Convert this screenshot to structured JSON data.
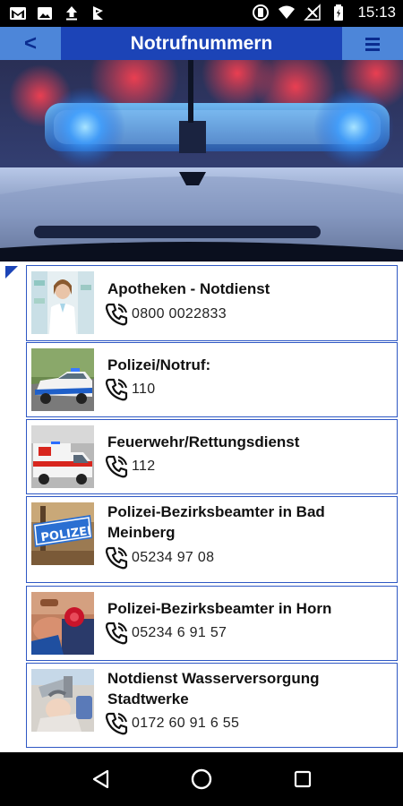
{
  "status_bar": {
    "time": "15:13",
    "left_icons": [
      "gmail-icon",
      "image-icon",
      "upload-icon",
      "flag-icon"
    ],
    "right_icons": [
      "vibrate-icon",
      "wifi-icon",
      "no-signal-icon",
      "battery-icon"
    ]
  },
  "app_bar": {
    "back_label": "<",
    "title": "Notrufnummern",
    "menu_icon": "menu-icon"
  },
  "hero": {
    "image": "police-car-lightbar-photo"
  },
  "entries": [
    {
      "title": "Apotheken - Notdienst",
      "phone": "0800 0022833",
      "thumb": "pharmacist-photo"
    },
    {
      "title": "Polizei/Notruf:",
      "phone": "110",
      "thumb": "police-car-photo"
    },
    {
      "title": "Feuerwehr/Rettungsdienst",
      "phone": "112",
      "thumb": "ambulance-photo"
    },
    {
      "title": "Polizei-Bezirksbeamter in Bad Meinberg",
      "phone": "05234 97 08",
      "thumb": "polizei-sign-photo"
    },
    {
      "title": "Polizei-Bezirksbeamter in Horn",
      "phone": "05234 6 91 57",
      "thumb": "police-officer-photo"
    },
    {
      "title": "Notdienst Wasserversorgung Stadtwerke",
      "phone": "0172 60 91 6 55",
      "thumb": "water-pipe-repair-photo"
    }
  ],
  "colors": {
    "app_bar": "#1c44b7",
    "app_bar_buttons": "#4d86d9",
    "item_border": "#2f58c4"
  },
  "nav_bar": {
    "buttons": [
      "back-nav-icon",
      "home-nav-icon",
      "recents-nav-icon"
    ]
  }
}
